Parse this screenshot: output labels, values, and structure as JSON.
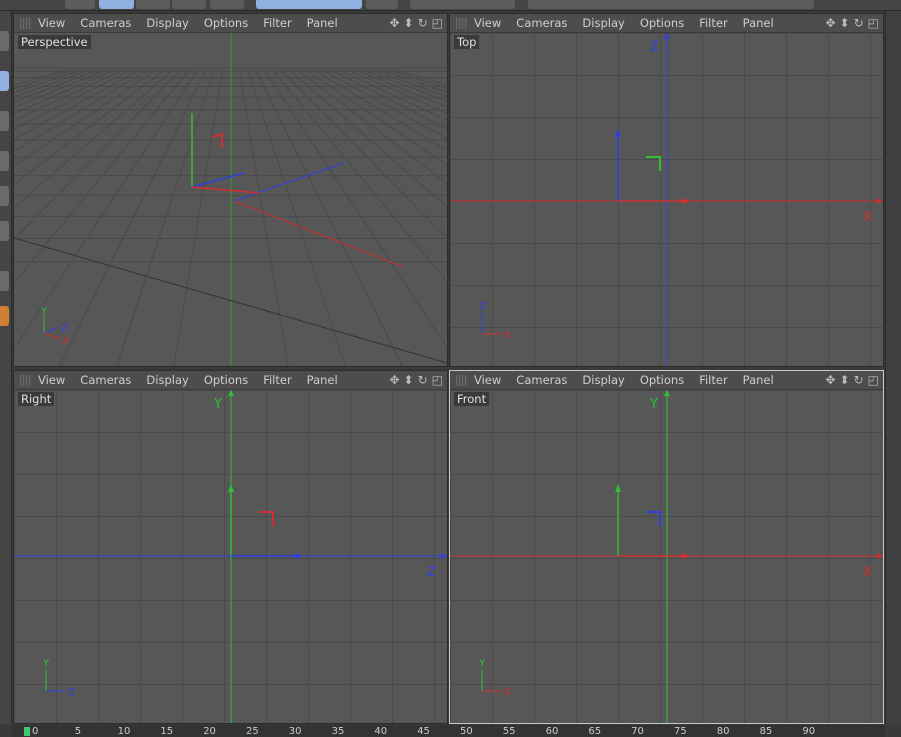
{
  "menu": [
    "View",
    "Cameras",
    "Display",
    "Options",
    "Filter",
    "Panel"
  ],
  "viewports": [
    {
      "label": "Perspective",
      "active": false
    },
    {
      "label": "Top",
      "active": false,
      "axis_h": "X",
      "axis_v": "Z"
    },
    {
      "label": "Right",
      "active": false,
      "axis_h": "Z",
      "axis_v": "Y"
    },
    {
      "label": "Front",
      "active": true,
      "axis_h": "X",
      "axis_v": "Y"
    }
  ],
  "nav_icons": [
    "move-view-icon",
    "zoom-view-icon",
    "rotate-view-icon",
    "toggle-view-icon"
  ],
  "timeline": {
    "ticks": [
      "0",
      "5",
      "10",
      "15",
      "20",
      "25",
      "30",
      "35",
      "40",
      "45",
      "50",
      "55",
      "60",
      "65",
      "70",
      "75",
      "80",
      "85",
      "90"
    ],
    "current_frame": 0
  },
  "colors": {
    "x_axis": "#d03030",
    "y_axis": "#30c030",
    "z_axis": "#3040e0",
    "active_border": "#c8c8c8"
  }
}
